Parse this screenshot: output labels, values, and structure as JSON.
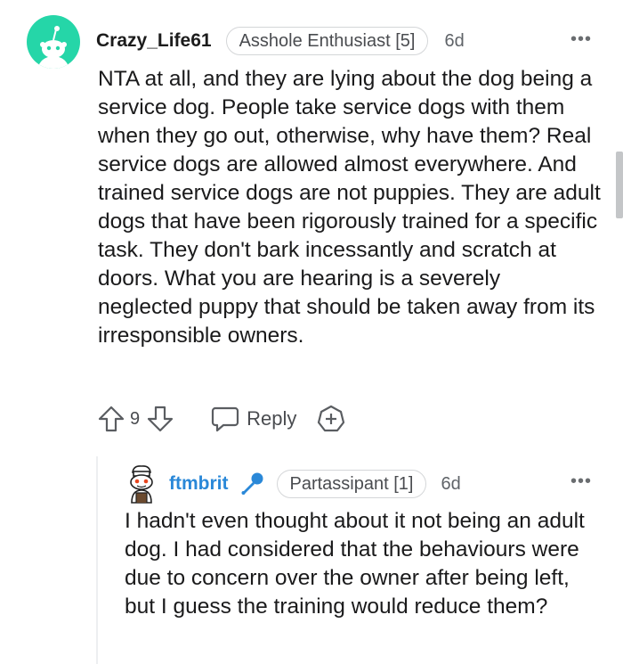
{
  "comment": {
    "username": "Crazy_Life61",
    "flair": "Asshole Enthusiast [5]",
    "age": "6d",
    "more": "•••",
    "body": "NTA at all, and they are lying about the dog being a service dog. People take service dogs with them when they go out, otherwise, why have them? Real service dogs are allowed almost everywhere. And trained service dogs are not puppies. They are adult dogs that have been rigorously trained for a specific task. They don't bark incessantly and scratch at doors. What you are hearing is a severely neglected puppy that should be taken away from its irresponsible owners.",
    "votes": "9",
    "reply_label": "Reply"
  },
  "reply": {
    "username": "ftmbrit",
    "flair": "Partassipant [1]",
    "age": "6d",
    "more": "•••",
    "body": "I hadn't even thought about it not being an adult dog. I had considered that the behaviours were due to concern over the owner after being left, but I guess the training would reduce them?"
  },
  "colors": {
    "avatar_bg": "#25d6a8",
    "reply_username": "#2a88d8",
    "mic_icon": "#2a88d8"
  }
}
